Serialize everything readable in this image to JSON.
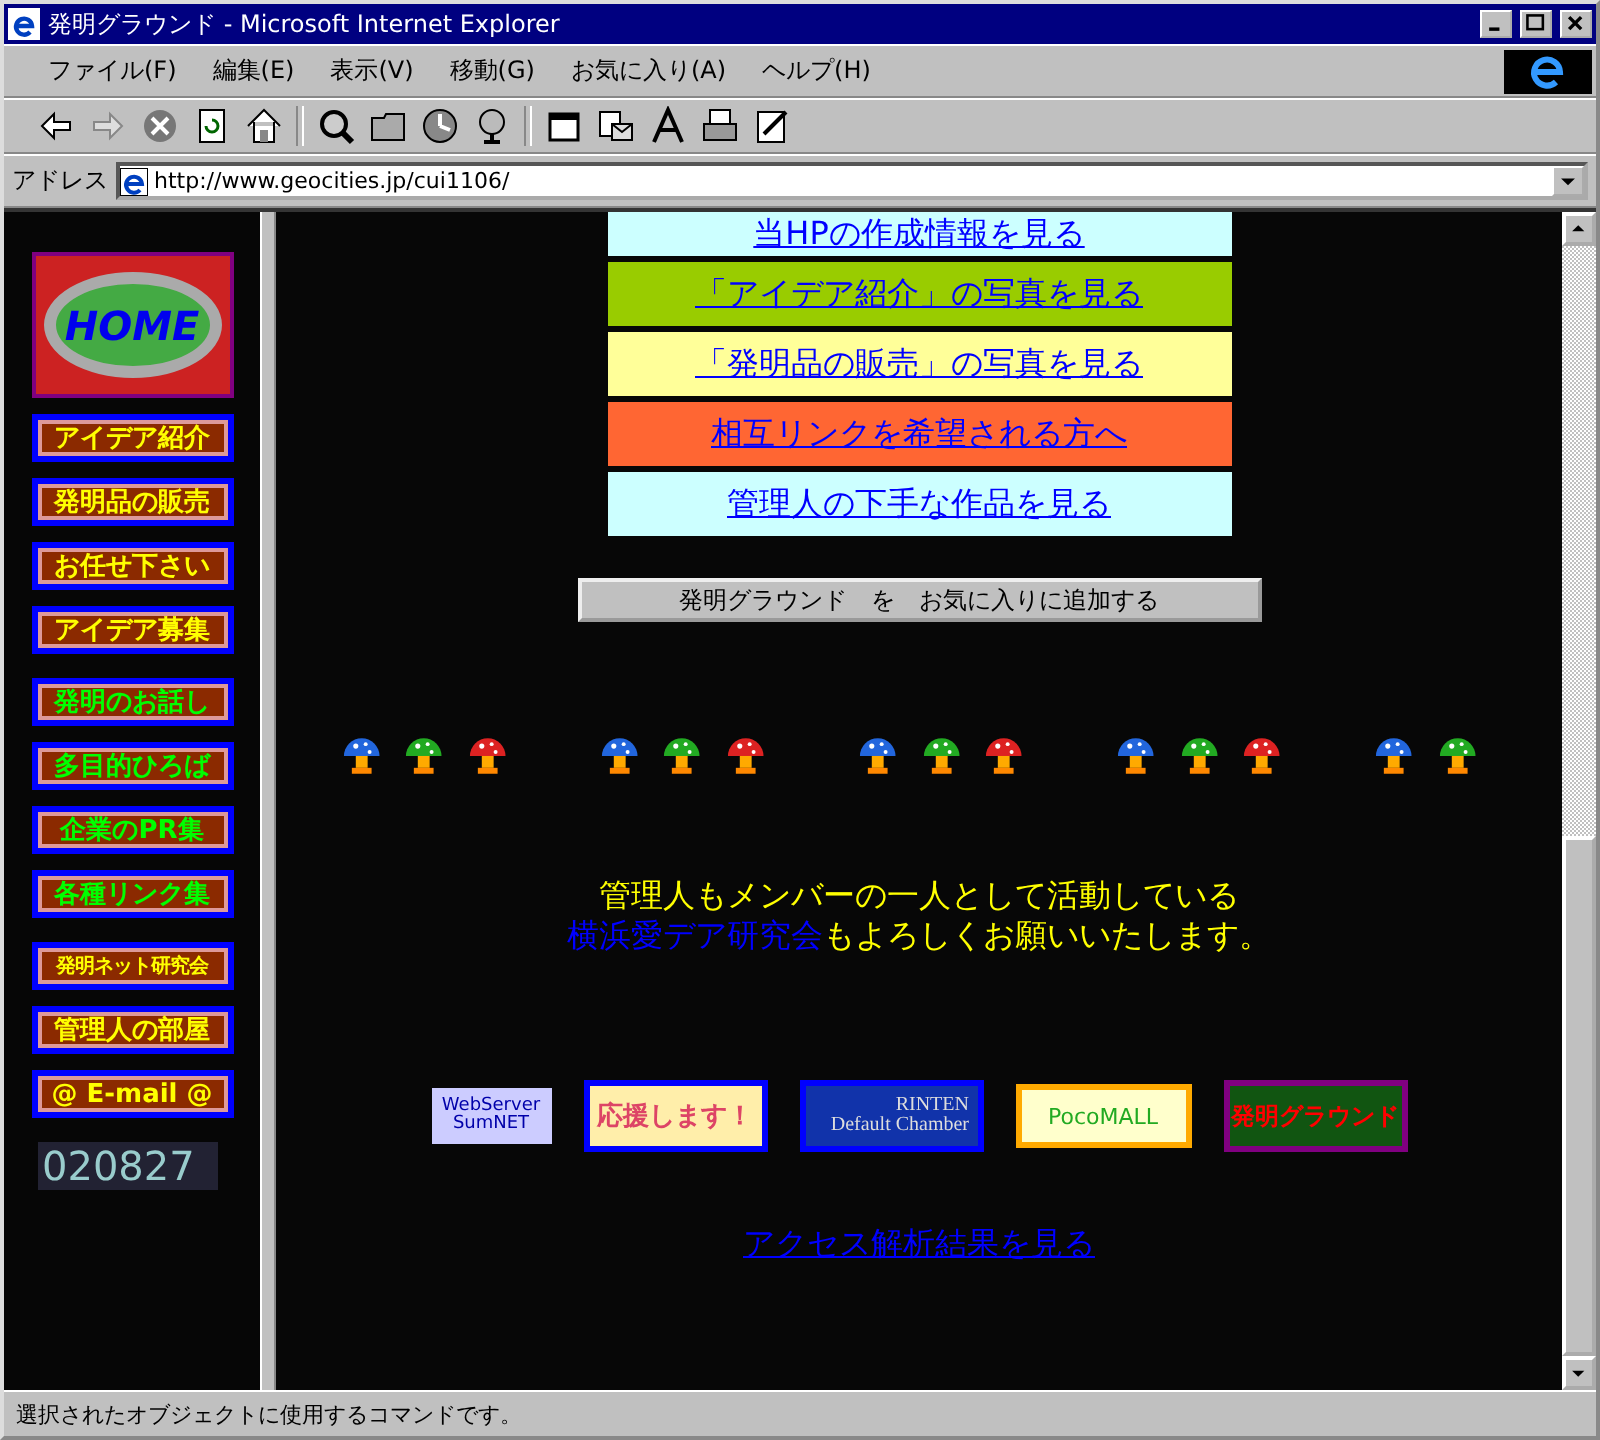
{
  "window": {
    "title": "発明グラウンド - Microsoft Internet Explorer"
  },
  "menu": [
    "ファイル(F)",
    "編集(E)",
    "表示(V)",
    "移動(G)",
    "お気に入り(A)",
    "ヘルプ(H)"
  ],
  "address_bar": {
    "label": "アドレス",
    "value": "http://www.geocities.jp/cui1106/"
  },
  "sidebar": {
    "home": "HOME",
    "items": [
      {
        "label": "アイデア紹介",
        "kind": "main"
      },
      {
        "label": "発明品の販売",
        "kind": "main"
      },
      {
        "label": "お任せ下さい",
        "kind": "main"
      },
      {
        "label": "アイデア募集",
        "kind": "main"
      },
      {
        "label": "発明のお話し",
        "kind": "extra"
      },
      {
        "label": "多目的ひろば",
        "kind": "extra"
      },
      {
        "label": "企業のPR集",
        "kind": "extra"
      },
      {
        "label": "各種リンク集",
        "kind": "extra"
      },
      {
        "label": "発明ネット研究会",
        "kind": "main"
      },
      {
        "label": "管理人の部屋",
        "kind": "main"
      },
      {
        "label": "@ E-mail @",
        "kind": "main"
      }
    ],
    "counter": "020827"
  },
  "links": [
    {
      "label": "当HPの作成情報を見る",
      "color": "#ccffff"
    },
    {
      "label": "「アイデア紹介」の写真を見る",
      "color": "#99cc00"
    },
    {
      "label": "「発明品の販売」の写真を見る",
      "color": "#ffff99"
    },
    {
      "label": "相互リンクを希望される方へ",
      "color": "#ff6633"
    },
    {
      "label": "管理人の下手な作品を見る",
      "color": "#ccffff"
    }
  ],
  "favorite_button": "発明グラウンド　を　お気に入りに追加する",
  "mushrooms": [
    {
      "color": "#2266dd"
    },
    {
      "color": "#22aa22"
    },
    {
      "color": "#dd2222"
    },
    {
      "color": "#2266dd"
    },
    {
      "color": "#22aa22"
    },
    {
      "color": "#dd2222"
    },
    {
      "color": "#2266dd"
    },
    {
      "color": "#22aa22"
    },
    {
      "color": "#dd2222"
    },
    {
      "color": "#2266dd"
    },
    {
      "color": "#22aa22"
    },
    {
      "color": "#dd2222"
    },
    {
      "color": "#2266dd"
    },
    {
      "color": "#22aa22"
    }
  ],
  "message": {
    "line1": "管理人もメンバーの一人として活動している",
    "link": "横浜愛デア研究会",
    "line2": "もよろしくお願いいたします。"
  },
  "banners": [
    {
      "kind": "sumnet",
      "lines": [
        "WebServer",
        "SumNET"
      ]
    },
    {
      "kind": "support",
      "lines": [
        "応援します！"
      ]
    },
    {
      "kind": "rinten",
      "lines": [
        "RINTEN",
        "Default Chamber"
      ]
    },
    {
      "kind": "pocomall",
      "lines": [
        "PocoMALL"
      ]
    },
    {
      "kind": "ground",
      "lines": [
        "発明グラウンド"
      ]
    }
  ],
  "access_link": "アクセス解析結果を見る",
  "status_bar": "選択されたオブジェクトに使用するコマンドです。"
}
